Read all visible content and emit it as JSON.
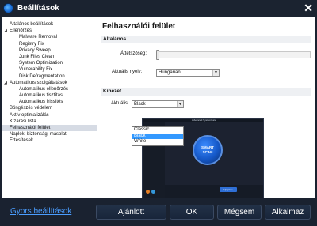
{
  "window": {
    "title": "Beállítások",
    "close_glyph": "✕",
    "app_icon": "app-logo-icon"
  },
  "sidebar": {
    "items": [
      {
        "label": "Általános beállítások",
        "level": 0,
        "toggle": ""
      },
      {
        "label": "Ellenőrzés",
        "level": 0,
        "toggle": "◢"
      },
      {
        "label": "Malware Removal",
        "level": 1,
        "toggle": ""
      },
      {
        "label": "Registry Fix",
        "level": 1,
        "toggle": ""
      },
      {
        "label": "Privacy Sweep",
        "level": 1,
        "toggle": ""
      },
      {
        "label": "Junk Files Clean",
        "level": 1,
        "toggle": ""
      },
      {
        "label": "System Optimization",
        "level": 1,
        "toggle": ""
      },
      {
        "label": "Vulnerability Fix",
        "level": 1,
        "toggle": ""
      },
      {
        "label": "Disk Defragmentation",
        "level": 1,
        "toggle": ""
      },
      {
        "label": "Automatikus szolgáltatások",
        "level": 0,
        "toggle": "◢"
      },
      {
        "label": "Automatikus ellenőrzés",
        "level": 1,
        "toggle": ""
      },
      {
        "label": "Automatikus tisztítás",
        "level": 1,
        "toggle": ""
      },
      {
        "label": "Automatikus frissítés",
        "level": 1,
        "toggle": ""
      },
      {
        "label": "Böngészés védelem",
        "level": 0,
        "toggle": ""
      },
      {
        "label": "Aktív optimalizálás",
        "level": 0,
        "toggle": ""
      },
      {
        "label": "Kizárási lista",
        "level": 0,
        "toggle": ""
      },
      {
        "label": "Felhasználói felület",
        "level": 0,
        "toggle": "",
        "selected": true
      },
      {
        "label": "Naplók, biztonsági másolat",
        "level": 0,
        "toggle": ""
      },
      {
        "label": "Értesítések",
        "level": 0,
        "toggle": ""
      }
    ]
  },
  "content": {
    "title": "Felhasználói felület",
    "general": {
      "header": "Általános",
      "opacity_label": "Áttetszőség:",
      "opacity_value": 0.0,
      "language_label": "Aktuális nyelv:",
      "language_value": "Hungarian"
    },
    "skin": {
      "header": "Kinézet",
      "current_label": "Aktuális",
      "current_value": "Black",
      "options": [
        "Classic",
        "Black",
        "White"
      ],
      "highlighted_option": "Black"
    },
    "preview": {
      "bar_title": "Advanced SystemCare",
      "circle_line1": "SMART",
      "circle_line2": "SCAN",
      "button_label": "Upgrade"
    }
  },
  "footer": {
    "quick_link": "Gyors beállítások",
    "buttons": {
      "recommended": "Ajánlott",
      "ok": "OK",
      "cancel": "Mégsem",
      "apply": "Alkalmaz"
    }
  }
}
